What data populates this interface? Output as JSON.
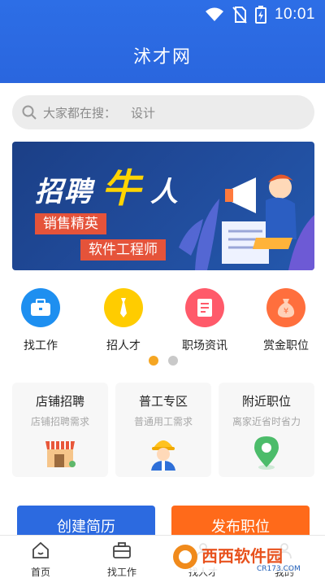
{
  "status": {
    "time": "10:01",
    "icons": [
      "wifi-icon",
      "no-sim-icon",
      "battery-charging-icon"
    ]
  },
  "app": {
    "title": "沭才网"
  },
  "search": {
    "label": "大家都在搜：",
    "keyword": "设计"
  },
  "banner": {
    "headline_left": "招聘",
    "headline_mid": "牛",
    "headline_right": "人",
    "tag1": "销售精英",
    "tag2": "软件工程师"
  },
  "quick": [
    {
      "label": "找工作",
      "icon": "briefcase-icon",
      "color": "#1e8ff0"
    },
    {
      "label": "招人才",
      "icon": "tie-icon",
      "color": "#ffcc00"
    },
    {
      "label": "职场资讯",
      "icon": "news-icon",
      "color": "#ff5a6a"
    },
    {
      "label": "赏金职位",
      "icon": "money-bag-icon",
      "color": "#ff6f3d"
    }
  ],
  "pager": {
    "active_color": "#f5a623",
    "inactive_color": "#c9c9c9"
  },
  "cards": [
    {
      "title": "店铺招聘",
      "subtitle": "店铺招聘需求",
      "icon": "shop-icon"
    },
    {
      "title": "普工专区",
      "subtitle": "普通用工需求",
      "icon": "worker-icon"
    },
    {
      "title": "附近职位",
      "subtitle": "离家近省时省力",
      "icon": "location-pin-icon"
    }
  ],
  "actions": {
    "create_resume": "创建简历",
    "post_job": "发布职位"
  },
  "tabs": [
    {
      "label": "首页",
      "icon": "home-icon"
    },
    {
      "label": "找工作",
      "icon": "briefcase-icon"
    },
    {
      "label": "找人才",
      "icon": "person-icon"
    },
    {
      "label": "我的",
      "icon": "user-icon"
    }
  ],
  "watermark": {
    "logo_text": "西西软件园",
    "domain": "CR173.COM"
  }
}
